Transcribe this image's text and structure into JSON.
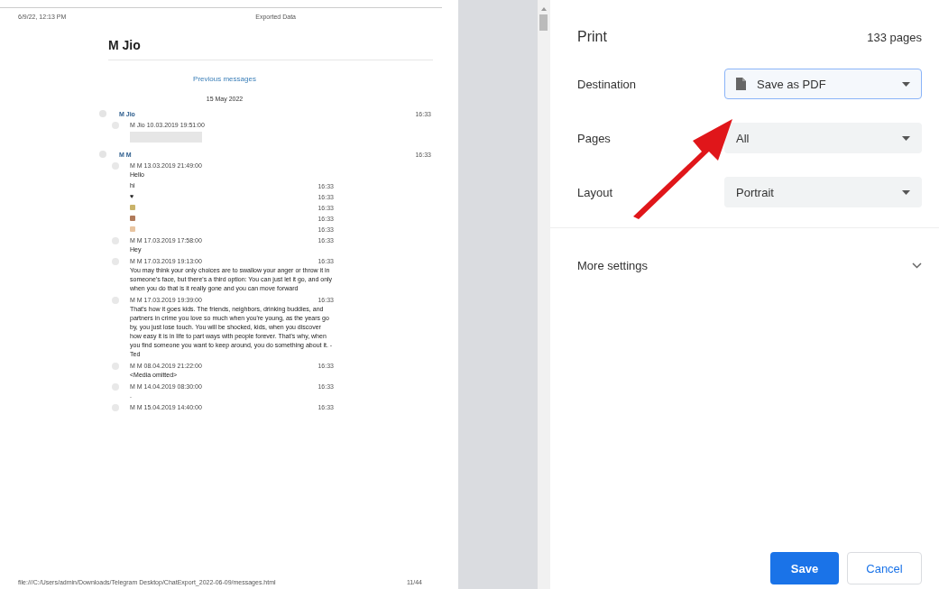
{
  "preview": {
    "header_date": "6/9/22, 12:13 PM",
    "header_title": "Exported Data",
    "chat_title": "M Jio",
    "previous_link": "Previous messages",
    "date_separator": "15 May 2022",
    "groups": [
      {
        "sender": "M Jio",
        "time": "16:33",
        "messages": [
          {
            "kind": "redacted",
            "meta": "M Jio 10.03.2019 19:51:00"
          }
        ]
      },
      {
        "sender": "M M",
        "time": "16:33",
        "messages": [
          {
            "kind": "text",
            "meta": "M M 13.03.2019 21:49:00",
            "text": "Hello"
          },
          {
            "kind": "line",
            "text": "hi",
            "time": "16:33"
          },
          {
            "kind": "line",
            "text": "♥",
            "time": "16:33"
          },
          {
            "kind": "emoji",
            "color": "#c9b36a",
            "time": "16:33"
          },
          {
            "kind": "emoji",
            "color": "#b07a5a",
            "time": "16:33"
          },
          {
            "kind": "emoji",
            "color": "#e8c4a0",
            "time": "16:33"
          },
          {
            "kind": "text",
            "meta": "M M 17.03.2019 17:58:00",
            "time": "16:33",
            "text": "Hey"
          },
          {
            "kind": "text",
            "meta": "M M 17.03.2019 19:13:00",
            "time": "16:33",
            "text": "You may think your only choices are to swallow your anger or throw it in someone's face, but there's a third option: You can just let it go, and only when you do that is it really gone and you can move forward"
          },
          {
            "kind": "text",
            "meta": "M M 17.03.2019 19:39:00",
            "time": "16:33",
            "text": "That's how it goes kids. The friends, neighbors, drinking buddies, and partners in crime you love so much when you're young, as the years go by, you just lose touch. You will be shocked, kids, when you discover how easy it is in life to part ways with people forever. That's why, when you find someone you want to keep around, you do something about it. - Ted"
          },
          {
            "kind": "text",
            "meta": "M M 08.04.2019 21:22:00",
            "time": "16:33",
            "text": "<Media omitted>"
          },
          {
            "kind": "text",
            "meta": "M M 14.04.2019 08:30:00",
            "time": "16:33",
            "text": "."
          },
          {
            "kind": "text",
            "meta": "M M 15.04.2019 14:40:00",
            "time": "16:33"
          }
        ]
      }
    ],
    "footer_path": "file:///C:/Users/admin/Downloads/Telegram Desktop/ChatExport_2022-06-09/messages.html",
    "footer_page": "11/44"
  },
  "print": {
    "title": "Print",
    "page_count": "133 pages",
    "settings": [
      {
        "label": "Destination",
        "value": "Save as PDF",
        "focused": true
      },
      {
        "label": "Pages",
        "value": "All",
        "focused": false
      },
      {
        "label": "Layout",
        "value": "Portrait",
        "focused": false
      }
    ],
    "more_settings": {
      "label": "More settings",
      "expanded": false
    },
    "buttons": [
      {
        "label": "Save",
        "kind": "primary"
      },
      {
        "label": "Cancel",
        "kind": "secondary"
      }
    ]
  }
}
